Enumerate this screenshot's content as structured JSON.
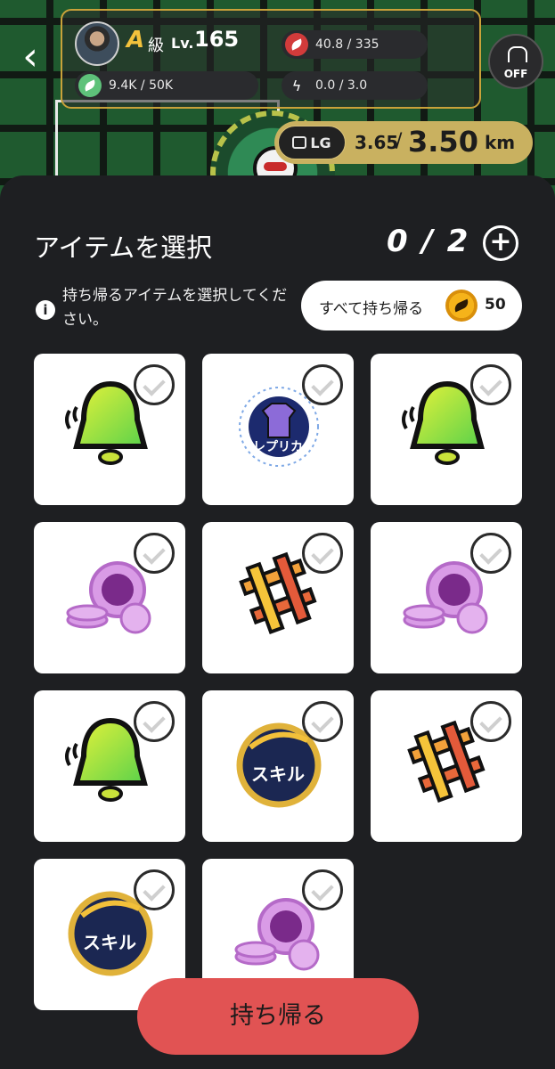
{
  "hud": {
    "rank": "A",
    "rank_suffix": "級",
    "level_label": "Lv.",
    "level": "165",
    "progress_text": "9.4K / 50K",
    "stat_text": "40.8 / 335",
    "energy_text": "0.0 / 3.0",
    "off_label": "OFF"
  },
  "distance": {
    "tag": "LG",
    "current": "3.65",
    "separator": "/",
    "goal": "3.50",
    "unit": "km"
  },
  "panel": {
    "title": "アイテムを選択",
    "count": "0 / 2",
    "plus": "+",
    "info_icon": "i",
    "info_text": "持ち帰るアイテムを選択してください。",
    "take_all_label": "すべて持ち帰る",
    "take_all_cost": "50"
  },
  "items": [
    {
      "type": "bell",
      "label": ""
    },
    {
      "type": "replica",
      "label": "レプリカ"
    },
    {
      "type": "bell",
      "label": ""
    },
    {
      "type": "coins",
      "label": ""
    },
    {
      "type": "mesh",
      "label": ""
    },
    {
      "type": "coins",
      "label": ""
    },
    {
      "type": "bell",
      "label": ""
    },
    {
      "type": "skill",
      "label": "スキル"
    },
    {
      "type": "mesh",
      "label": ""
    },
    {
      "type": "skill",
      "label": "スキル"
    },
    {
      "type": "coins",
      "label": ""
    }
  ],
  "footer": {
    "bring_label": "持ち帰る"
  },
  "colors": {
    "accent": "#e15353",
    "gold": "#c9a23a",
    "sheet_bg": "#1e1f22"
  }
}
